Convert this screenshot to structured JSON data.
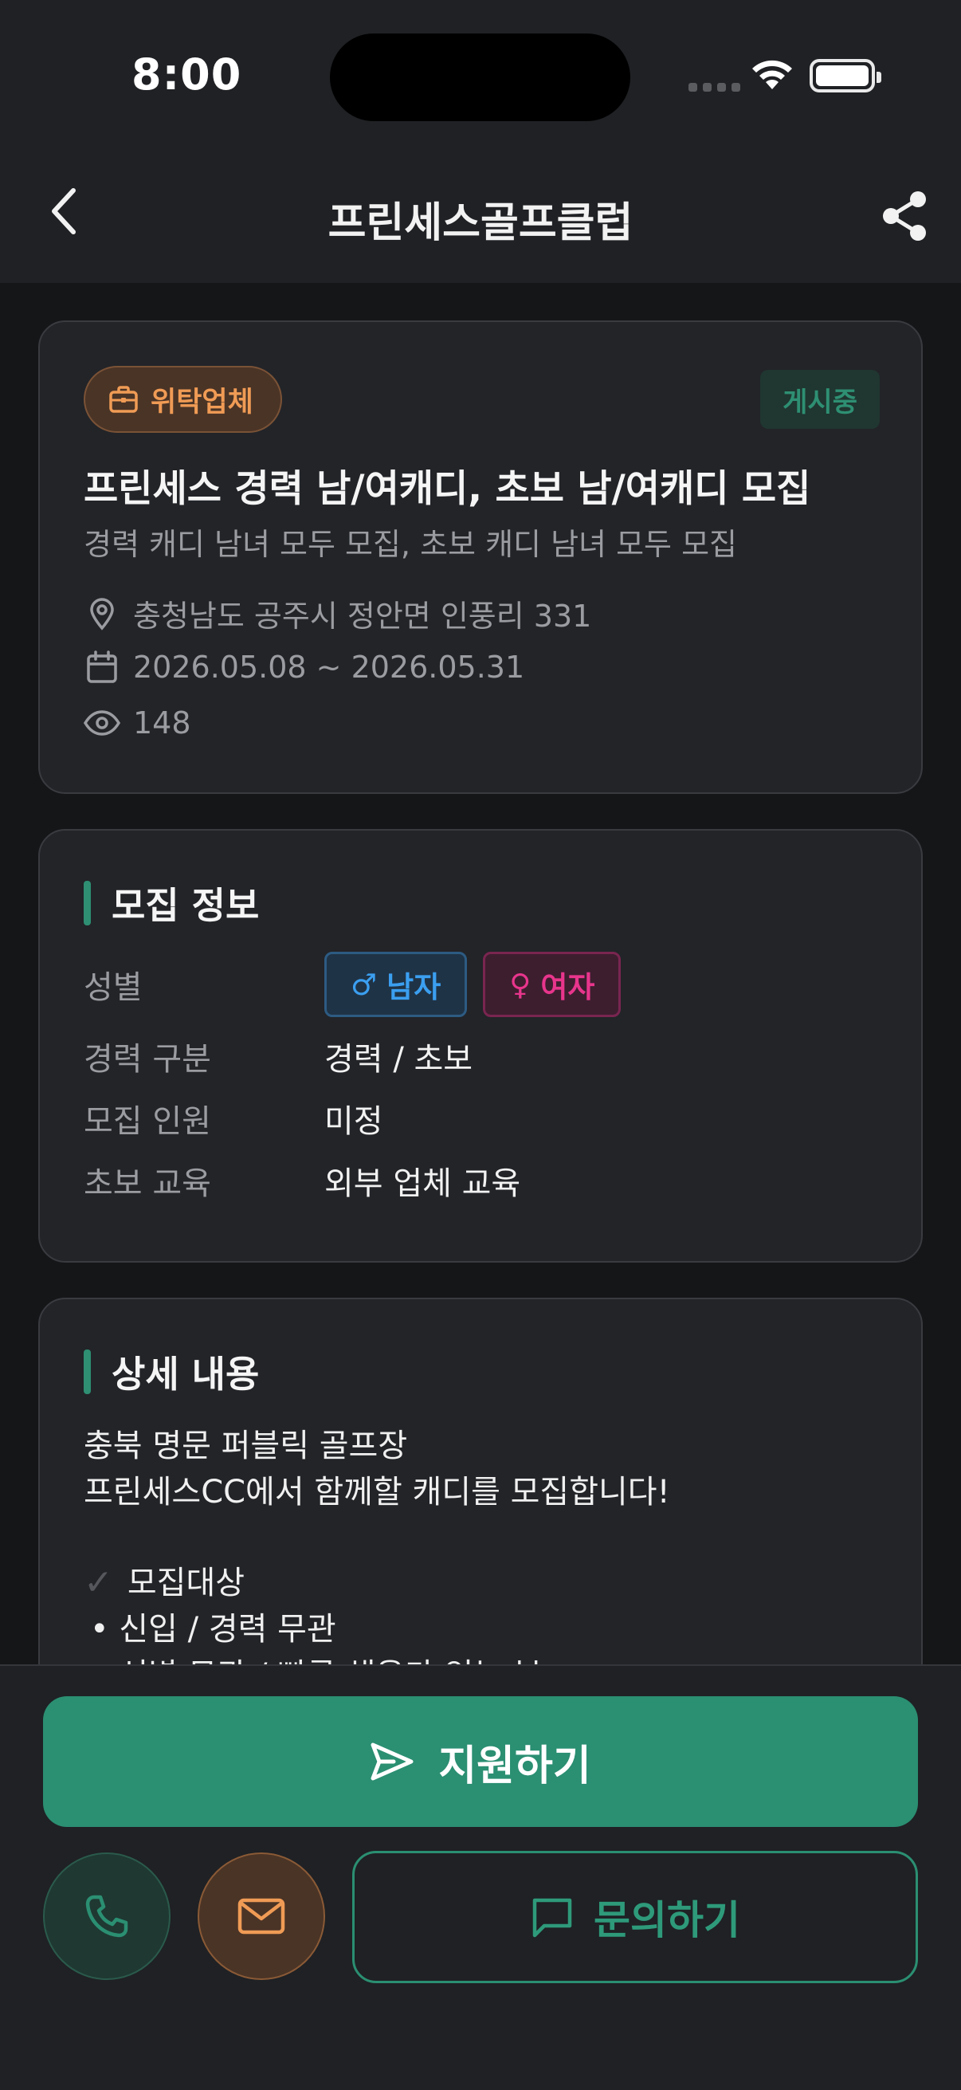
{
  "status_bar": {
    "time": "8:00"
  },
  "nav": {
    "title": "프린세스골프클럽"
  },
  "post": {
    "type_badge": "위탁업체",
    "status_badge": "게시중",
    "title": "프린세스 경력 남/여캐디, 초보 남/여캐디 모집",
    "subtitle": "경력 캐디 남녀 모두 모집, 초보 캐디 남녀 모두 모집",
    "location": "충청남도 공주시 정안면 인풍리 331",
    "period": "2026.05.08 ~ 2026.05.31",
    "views": "148"
  },
  "recruit_info": {
    "section_title": "모집 정보",
    "gender_label": "성별",
    "gender_male": "남자",
    "gender_female": "여자",
    "male_symbol": "♂",
    "female_symbol": "♀",
    "career_label": "경력 구분",
    "career_value": "경력 / 초보",
    "count_label": "모집 인원",
    "count_value": "미정",
    "edu_label": "초보 교육",
    "edu_value": "외부 업체 교육"
  },
  "details": {
    "section_title": "상세 내용",
    "line1": "충북 명문 퍼블릭 골프장",
    "line2": "프린세스CC에서 함께할 캐디를 모집합니다!",
    "check_mark": "✓",
    "target_heading": "모집대상",
    "bullet1": "• 신입 / 경력 무관",
    "bullet2": "• 성별 무관 / 빠른 채용가 있는 분"
  },
  "actions": {
    "apply_label": "지원하기",
    "inquiry_label": "문의하기"
  },
  "colors": {
    "accent_green": "#2b8f72",
    "accent_orange": "#f09b55",
    "male_blue": "#3b9ff0",
    "female_pink": "#e8358c",
    "background": "#151618",
    "card": "#222428"
  }
}
